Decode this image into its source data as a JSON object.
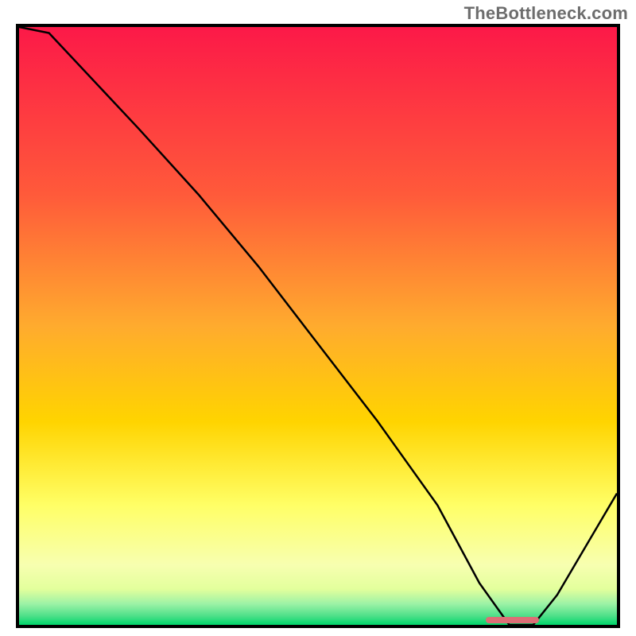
{
  "watermark": "TheBottleneck.com",
  "colors": {
    "gradient_top": "#fc1948",
    "gradient_mid1": "#ff6f3c",
    "gradient_mid2": "#ffd400",
    "gradient_mid3": "#ffff66",
    "gradient_mid4": "#e3ff9c",
    "gradient_bottom": "#00d66b",
    "curve": "#000000",
    "marker": "#dd6e76",
    "frame": "#000000"
  },
  "chart_data": {
    "type": "line",
    "title": "",
    "xlabel": "",
    "ylabel": "",
    "xlim": [
      0,
      100
    ],
    "ylim": [
      0,
      100
    ],
    "x": [
      0,
      5,
      20,
      30,
      40,
      50,
      60,
      70,
      77,
      82,
      86,
      90,
      100
    ],
    "values": [
      104,
      99,
      83,
      72,
      60,
      47,
      34,
      20,
      7,
      0,
      0,
      5,
      22
    ],
    "marker_region": {
      "x_start": 78,
      "x_end": 87,
      "y": 0
    },
    "grid": false,
    "notes": "Gradient background red→green top-to-bottom; black V-shaped curve; short pink marker on baseline near x≈80–87."
  }
}
